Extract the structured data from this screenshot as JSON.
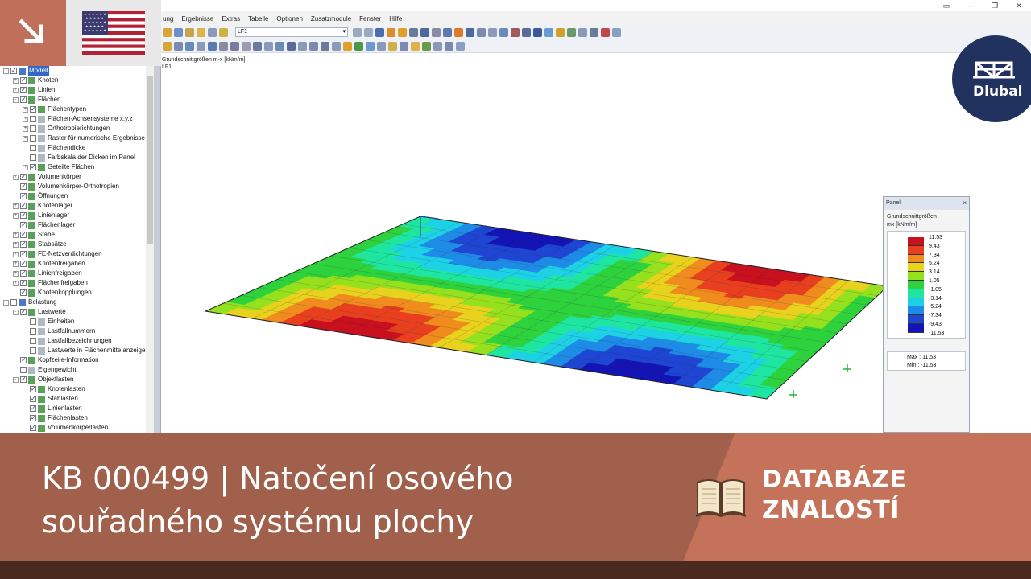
{
  "menu": {
    "items": [
      "ung",
      "Ergebnisse",
      "Extras",
      "Tabelle",
      "Optionen",
      "Zusatzmodule",
      "Fenster",
      "Hilfe"
    ]
  },
  "toolbar": {
    "loadcase_value": "LF1"
  },
  "canvas": {
    "title": "Grundschnittgrößen m-x [kNm/m]",
    "subtitle": "LF1"
  },
  "navigator": {
    "items": [
      {
        "label": "Modell",
        "level": 0,
        "expander": "-",
        "checked": true,
        "selected": true
      },
      {
        "label": "Knoten",
        "level": 1,
        "expander": "+",
        "checked": true
      },
      {
        "label": "Linien",
        "level": 1,
        "expander": "+",
        "checked": true
      },
      {
        "label": "Flächen",
        "level": 1,
        "expander": "-",
        "checked": true
      },
      {
        "label": "Flächentypen",
        "level": 2,
        "expander": "+",
        "checked": true
      },
      {
        "label": "Flächen-Achsensysteme x,y,z",
        "level": 2,
        "expander": "+",
        "checked": false
      },
      {
        "label": "Orthotropierichtungen",
        "level": 2,
        "expander": "+",
        "checked": false
      },
      {
        "label": "Raster für numerische Ergebnisse",
        "level": 2,
        "expander": "+",
        "checked": false
      },
      {
        "label": "Flächendicke",
        "level": 2,
        "expander": "",
        "checked": false
      },
      {
        "label": "Farbskala der Dicken im Panel",
        "level": 2,
        "expander": "",
        "checked": false
      },
      {
        "label": "Geteilte Flächen",
        "level": 2,
        "expander": "+",
        "checked": true
      },
      {
        "label": "Volumenkörper",
        "level": 1,
        "expander": "+",
        "checked": true
      },
      {
        "label": "Volumenkörper-Orthotropien",
        "level": 1,
        "expander": "",
        "checked": true
      },
      {
        "label": "Öffnungen",
        "level": 1,
        "expander": "",
        "checked": true
      },
      {
        "label": "Knotenlager",
        "level": 1,
        "expander": "+",
        "checked": true
      },
      {
        "label": "Linienlager",
        "level": 1,
        "expander": "+",
        "checked": true
      },
      {
        "label": "Flächenlager",
        "level": 1,
        "expander": "",
        "checked": true
      },
      {
        "label": "Stäbe",
        "level": 1,
        "expander": "+",
        "checked": true
      },
      {
        "label": "Stabsätze",
        "level": 1,
        "expander": "+",
        "checked": true
      },
      {
        "label": "FE-Netzverdichtungen",
        "level": 1,
        "expander": "+",
        "checked": true
      },
      {
        "label": "Knotenfreigaben",
        "level": 1,
        "expander": "+",
        "checked": true
      },
      {
        "label": "Linienfreigaben",
        "level": 1,
        "expander": "+",
        "checked": true
      },
      {
        "label": "Flächenfreigaben",
        "level": 1,
        "expander": "+",
        "checked": true
      },
      {
        "label": "Knotenkopplungen",
        "level": 1,
        "expander": "",
        "checked": true
      },
      {
        "label": "Belastung",
        "level": 0,
        "expander": "-",
        "checked": false
      },
      {
        "label": "Lastwerte",
        "level": 1,
        "expander": "-",
        "checked": true
      },
      {
        "label": "Einheiten",
        "level": 2,
        "expander": "",
        "checked": false
      },
      {
        "label": "Lastfallnummern",
        "level": 2,
        "expander": "",
        "checked": false
      },
      {
        "label": "Lastfallbezeichnungen",
        "level": 2,
        "expander": "",
        "checked": false
      },
      {
        "label": "Lastwerte in Flächenmitte anzeigen",
        "level": 2,
        "expander": "",
        "checked": false
      },
      {
        "label": "Kopfzeile-Information",
        "level": 1,
        "expander": "",
        "checked": true
      },
      {
        "label": "Eigengewicht",
        "level": 1,
        "expander": "",
        "checked": false
      },
      {
        "label": "Objektlasten",
        "level": 1,
        "expander": "-",
        "checked": true
      },
      {
        "label": "Knotenlasten",
        "level": 2,
        "expander": "",
        "checked": true
      },
      {
        "label": "Stablasten",
        "level": 2,
        "expander": "",
        "checked": true
      },
      {
        "label": "Linienlasten",
        "level": 2,
        "expander": "",
        "checked": true
      },
      {
        "label": "Flächenlasten",
        "level": 2,
        "expander": "",
        "checked": true
      },
      {
        "label": "Volumenkörperlasten",
        "level": 2,
        "expander": "",
        "checked": true
      }
    ]
  },
  "panel": {
    "title": "Panel",
    "close": "×",
    "heading": "Grundschnittgrößen",
    "unit": "mx [kNm/m]",
    "scale_values": [
      "11.53",
      "9.43",
      "7.34",
      "5.24",
      "3.14",
      "1.05",
      "-1.05",
      "-3.14",
      "-5.24",
      "-7.34",
      "-9.43",
      "-11.53"
    ],
    "scale_colors": [
      "#c8101e",
      "#e8401e",
      "#f08c1e",
      "#e8d21e",
      "#96e11e",
      "#2ed23c",
      "#1ee6a0",
      "#1ed2e6",
      "#1e8ce6",
      "#1e46d2",
      "#1414b4"
    ],
    "max_label": "Max :",
    "max_value": "11.53",
    "min_label": "Min :",
    "min_value": "-11.53"
  },
  "logo": {
    "text": "Dlubal"
  },
  "banner": {
    "title": "KB 000499 | Natočení osového souřadného systému plochy",
    "category_line1": "DATABÁZE",
    "category_line2": "ZNALOSTÍ"
  }
}
